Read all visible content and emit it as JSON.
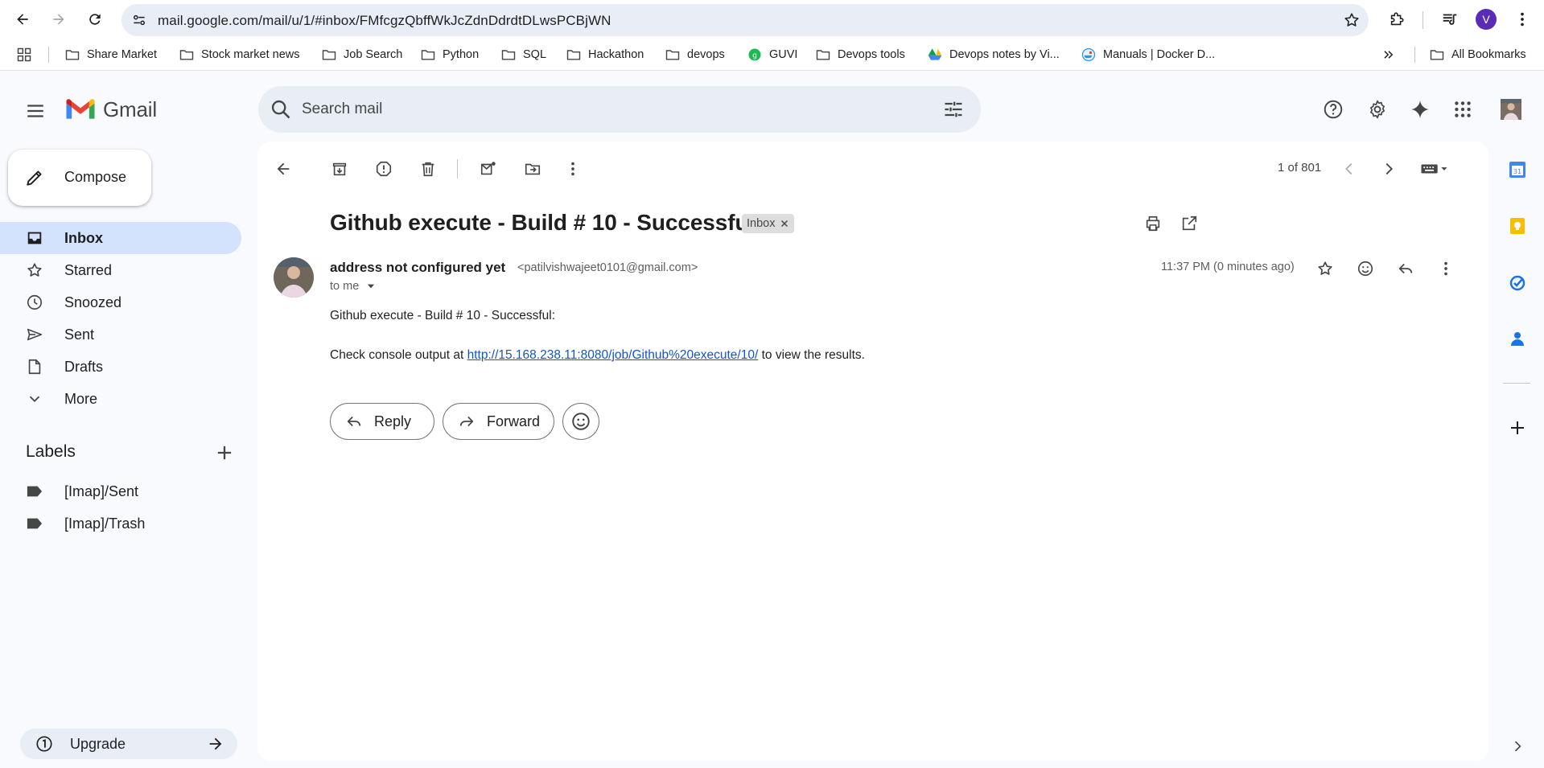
{
  "browser": {
    "url": "mail.google.com/mail/u/1/#inbox/FMfcgzQbffWkJcZdnDdrdtDLwsPCBjWN",
    "profile_initial": "V",
    "bookmarks": [
      {
        "label": "Share Market",
        "icon": "folder-icon"
      },
      {
        "label": "Stock market news",
        "icon": "folder-icon"
      },
      {
        "label": "Job Search",
        "icon": "folder-icon"
      },
      {
        "label": "Python",
        "icon": "folder-icon"
      },
      {
        "label": "SQL",
        "icon": "folder-icon"
      },
      {
        "label": "Hackathon",
        "icon": "folder-icon"
      },
      {
        "label": "devops",
        "icon": "folder-icon"
      },
      {
        "label": "GUVI",
        "icon": "guvi-icon"
      },
      {
        "label": "Devops tools",
        "icon": "folder-icon"
      },
      {
        "label": "Devops notes by Vi...",
        "icon": "drive-icon"
      },
      {
        "label": "Manuals | Docker D...",
        "icon": "docker-icon"
      }
    ],
    "all_bookmarks_label": "All Bookmarks"
  },
  "gmail": {
    "logo_text": "Gmail",
    "search_placeholder": "Search mail",
    "compose_label": "Compose",
    "nav": [
      {
        "label": "Inbox",
        "icon": "inbox-icon",
        "active": true
      },
      {
        "label": "Starred",
        "icon": "star-icon"
      },
      {
        "label": "Snoozed",
        "icon": "clock-icon"
      },
      {
        "label": "Sent",
        "icon": "send-icon"
      },
      {
        "label": "Drafts",
        "icon": "draft-icon"
      },
      {
        "label": "More",
        "icon": "chevron-down-icon"
      }
    ],
    "labels_heading": "Labels",
    "labels": [
      {
        "label": "[Imap]/Sent",
        "icon": "label-icon"
      },
      {
        "label": "[Imap]/Trash",
        "icon": "label-icon"
      }
    ],
    "upgrade_label": "Upgrade"
  },
  "message": {
    "pager": "1 of 801",
    "subject": "Github execute - Build # 10 - Successful!",
    "chip_label": "Inbox",
    "sender_name": "address not configured yet",
    "sender_email": "<patilvishwajeet0101@gmail.com>",
    "recipient": "to me",
    "timestamp": "11:37 PM (0 minutes ago)",
    "body_line1": "Github execute - Build # 10 - Successful:",
    "body_prefix": "Check console output at ",
    "body_link": "http://15.168.238.11:8080/job/Github%20execute/10/",
    "body_suffix": " to view the results.",
    "reply_label": "Reply",
    "forward_label": "Forward"
  },
  "colors": {
    "active_nav": "#d3e3fd",
    "link": "#1155cc",
    "gmail_red": "#ea4335",
    "gmail_blue": "#4285f4",
    "gmail_green": "#34a853",
    "gmail_yellow": "#fbbc04"
  }
}
